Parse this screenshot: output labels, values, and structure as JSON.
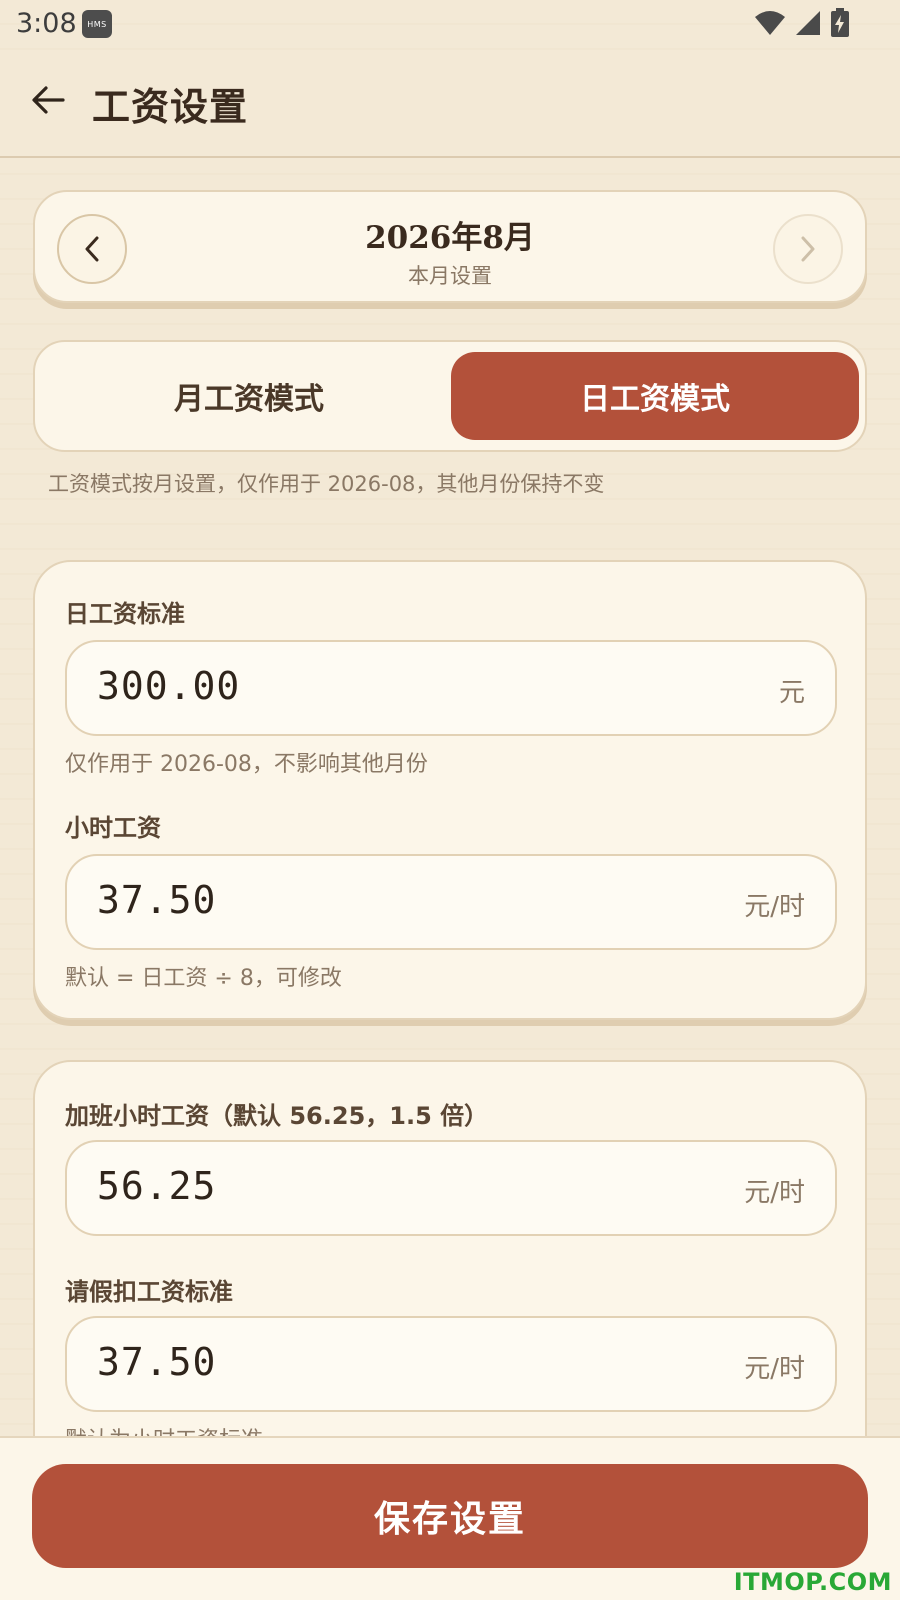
{
  "status_bar": {
    "time": "3:08",
    "badge": "HMS"
  },
  "app_bar": {
    "title": "工资设置"
  },
  "month": {
    "title": "2026年8月",
    "subtitle": "本月设置"
  },
  "mode": {
    "options": [
      "月工资模式",
      "日工资模式"
    ],
    "selected": "日工资模式",
    "hint": "工资模式按月设置，仅作用于 2026-08，其他月份保持不变"
  },
  "daily_wage": {
    "label": "日工资标准",
    "value": "300.00",
    "unit": "元",
    "hint": "仅作用于 2026-08，不影响其他月份"
  },
  "hourly_wage": {
    "label": "小时工资",
    "value": "37.50",
    "unit": "元/时",
    "hint": "默认 = 日工资 ÷ 8，可修改"
  },
  "overtime_wage": {
    "label": "加班小时工资（默认 56.25，1.5 倍）",
    "value": "56.25",
    "unit": "元/时"
  },
  "leave_deduction": {
    "label": "请假扣工资标准",
    "value": "37.50",
    "unit": "元/时",
    "hint": "默认为小时工资标准"
  },
  "save_label": "保存设置",
  "watermark": "ITMOP.COM",
  "colors": {
    "accent": "#b3513a",
    "background": "#f3e9d7",
    "card": "#fcf6e9"
  }
}
